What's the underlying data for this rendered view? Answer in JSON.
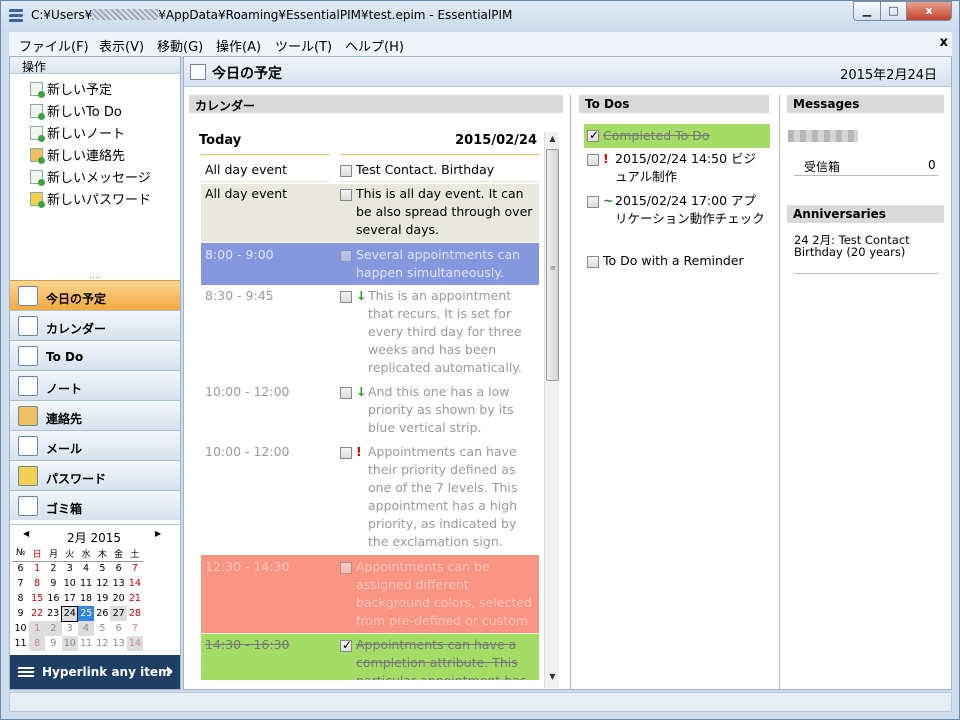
{
  "window": {
    "title_prefix": "C:¥Users¥",
    "title_suffix": "¥AppData¥Roaming¥EssentialPIM¥test.epim - EssentialPIM",
    "min_label": "▁",
    "max_label": "□",
    "close_label": "x"
  },
  "menu": {
    "items": [
      "ファイル(F)",
      "表示(V)",
      "移動(G)",
      "操作(A)",
      "ツール(T)",
      "ヘルプ(H)"
    ],
    "close_label": "x"
  },
  "sidebar": {
    "header": "操作",
    "actions": [
      "新しい予定",
      "新しいTo Do",
      "新しいノート",
      "新しい連絡先",
      "新しいメッセージ",
      "新しいパスワード"
    ],
    "grip": "....",
    "nav": [
      "今日の予定",
      "カレンダー",
      "To Do",
      "ノート",
      "連絡先",
      "メール",
      "パスワード",
      "ゴミ箱"
    ],
    "active_nav_index": 0,
    "hyperlink_label": "Hyperlink any item",
    "hyperlink_arrow": "›"
  },
  "mini_cal": {
    "prev": "◀",
    "next": "▶",
    "title": "2月  2015",
    "headers": [
      "№",
      "日",
      "月",
      "火",
      "水",
      "木",
      "金",
      "土"
    ],
    "weeks": [
      [
        "6",
        "1",
        "2",
        "3",
        "4",
        "5",
        "6",
        "7"
      ],
      [
        "7",
        "8",
        "9",
        "10",
        "11",
        "12",
        "13",
        "14"
      ],
      [
        "8",
        "15",
        "16",
        "17",
        "18",
        "19",
        "20",
        "21"
      ],
      [
        "9",
        "22",
        "23",
        "24",
        "25",
        "26",
        "27",
        "28"
      ],
      [
        "10",
        "1",
        "2",
        "3",
        "4",
        "5",
        "6",
        "7"
      ],
      [
        "11",
        "8",
        "9",
        "10",
        "11",
        "12",
        "13",
        "14"
      ]
    ]
  },
  "main": {
    "title": "今日の予定",
    "date": "2015年2月24日"
  },
  "calendar": {
    "header": "カレンダー",
    "today_label": "Today",
    "today_date": "2015/02/24",
    "events": [
      {
        "time": "All day event",
        "pri": "",
        "text": "Test Contact. Birthday"
      },
      {
        "time": "All day event",
        "pri": "",
        "text": "This is all day event. It can be also spread through over several days."
      },
      {
        "time": "8:00 - 9:00",
        "pri": "",
        "text": "Several appointments can happen simultaneously."
      },
      {
        "time": "8:30 - 9:45",
        "pri": "↓",
        "text": "This is an appointment that recurs. It is set for every third day for three weeks and has been replicated automatically."
      },
      {
        "time": "10:00 - 12:00",
        "pri": "↓",
        "text": "And this one has a low priority as shown by its blue vertical strip."
      },
      {
        "time": "10:00 - 12:00",
        "pri": "!",
        "text": "Appointments can have their priority defined as one of the 7 levels. This appointment has a high priority, as indicated by the exclamation sign."
      },
      {
        "time": "12:30 - 14:30",
        "pri": "",
        "text": "Appointments can be assigned different background colors, selected from pre-defined or custom colors."
      },
      {
        "time": "14:30 - 16:30",
        "pri": "",
        "text": "Appointments can have a completion attribute. This particular appointment has"
      }
    ],
    "scroll_up": "▲",
    "scroll_down": "▼",
    "scroll_grip": "≡"
  },
  "todos": {
    "header": "To Dos",
    "items": [
      {
        "pri": "",
        "text": "Completed To Do"
      },
      {
        "pri": "!",
        "text": "2015/02/24 14:50 ビジュアル制作"
      },
      {
        "pri": "~",
        "text": "2015/02/24 17:00 アプリケーション動作チェック"
      },
      {
        "pri": "",
        "text": "To Do with a Reminder"
      }
    ]
  },
  "messages": {
    "header": "Messages",
    "inbox_label": "受信箱",
    "inbox_count": "0"
  },
  "anniversaries": {
    "header": "Anniversaries",
    "line1": "24 2月:  Test Contact",
    "line2": "Birthday  (20 years)"
  },
  "colors": {
    "active_nav": "#f5a93f",
    "event_allday": "#e8e8dc",
    "event_blue": "#8597df",
    "event_red": "#fa9483",
    "event_green": "#a4dd66",
    "priority_high": "#cc0000",
    "priority_low": "#2a9d2a"
  }
}
